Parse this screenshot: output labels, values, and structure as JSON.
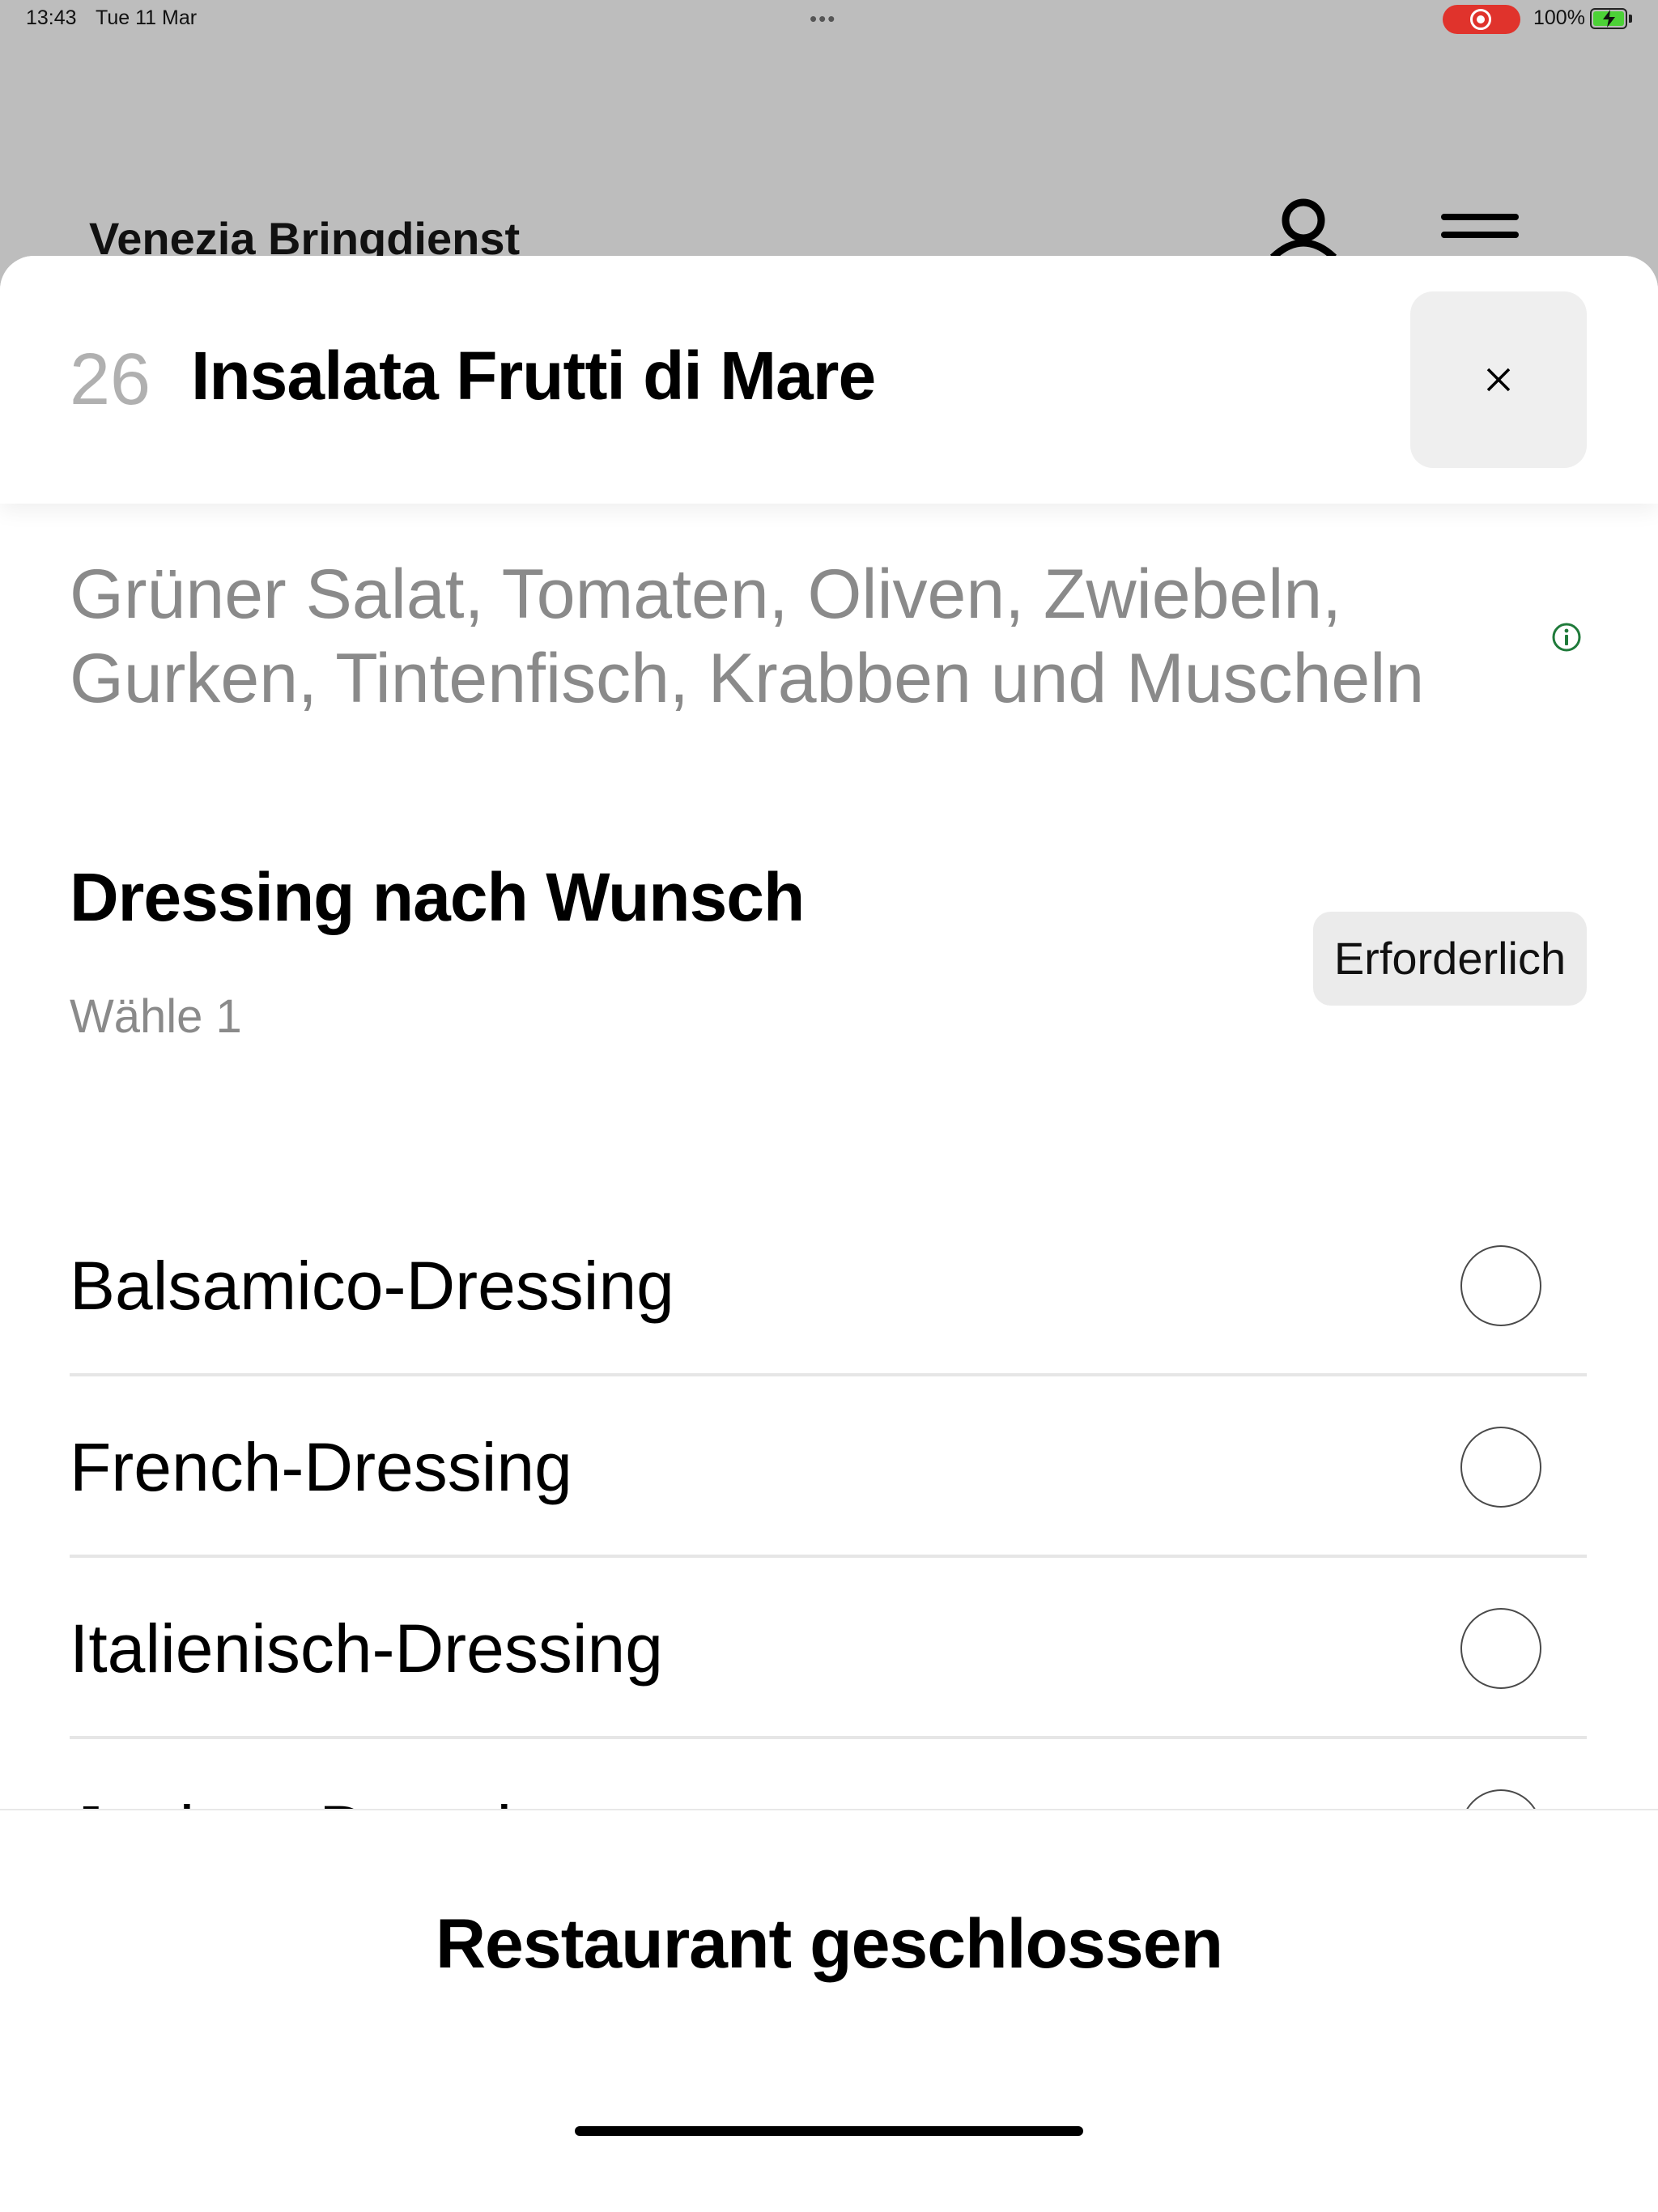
{
  "status_bar": {
    "time": "13:43",
    "date": "Tue 11 Mar",
    "dots": "•••",
    "battery_percent": "100%",
    "recording_color": "#e0332c",
    "battery_color": "#4cd137",
    "battery_level": 1.0
  },
  "background_page": {
    "title": "Venezia Bringdienst",
    "icons": [
      "user-icon",
      "menu-icon"
    ]
  },
  "sheet": {
    "item_number": "26",
    "item_title": "Insalata Frutti di Mare",
    "close_label": "×",
    "description": "Grüner Salat, Tomaten, Oliven, Zwiebeln, Gurken, Tintenfisch, Krabben und Muscheln",
    "info_icon": "info-icon",
    "accent_color": "#1f7a3a"
  },
  "dressing_section": {
    "title": "Dressing nach Wunsch",
    "subtitle": "Wähle 1",
    "badge": "Erforderlich",
    "options": [
      {
        "label": "Balsamico-Dressing",
        "selected": false
      },
      {
        "label": "French-Dressing",
        "selected": false
      },
      {
        "label": "Italienisch-Dressing",
        "selected": false
      },
      {
        "label": "Joghurt-Dressing",
        "selected": false
      }
    ]
  },
  "footer": {
    "status_text": "Restaurant geschlossen"
  }
}
